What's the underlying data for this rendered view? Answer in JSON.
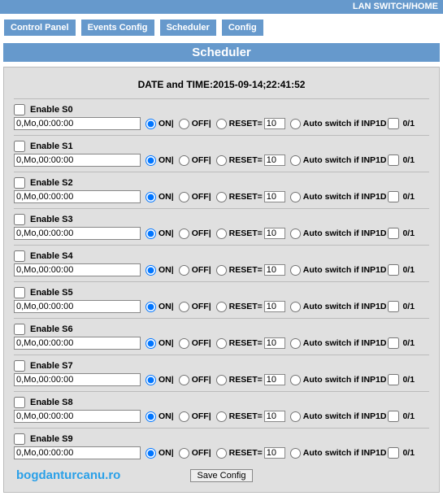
{
  "topbar": {
    "text": "LAN SWITCH/HOME"
  },
  "tabs": [
    {
      "label": "Control Panel"
    },
    {
      "label": "Events Config"
    },
    {
      "label": "Scheduler"
    },
    {
      "label": "Config"
    }
  ],
  "title": "Scheduler",
  "datetime_label": "DATE and TIME:",
  "datetime_value": "2015-09-14;22:41:52",
  "labels": {
    "on": "ON|",
    "off": "OFF|",
    "reset": "RESET=",
    "auto": "Auto switch if INP1D",
    "zeroone": "0/1"
  },
  "rows": [
    {
      "enable_label": "Enable S0",
      "value": "0,Mo,00:00:00",
      "reset": "10"
    },
    {
      "enable_label": "Enable S1",
      "value": "0,Mo,00:00:00",
      "reset": "10"
    },
    {
      "enable_label": "Enable S2",
      "value": "0,Mo,00:00:00",
      "reset": "10"
    },
    {
      "enable_label": "Enable S3",
      "value": "0,Mo,00:00:00",
      "reset": "10"
    },
    {
      "enable_label": "Enable S4",
      "value": "0,Mo,00:00:00",
      "reset": "10"
    },
    {
      "enable_label": "Enable S5",
      "value": "0,Mo,00:00:00",
      "reset": "10"
    },
    {
      "enable_label": "Enable S6",
      "value": "0,Mo,00:00:00",
      "reset": "10"
    },
    {
      "enable_label": "Enable S7",
      "value": "0,Mo,00:00:00",
      "reset": "10"
    },
    {
      "enable_label": "Enable S8",
      "value": "0,Mo,00:00:00",
      "reset": "10"
    },
    {
      "enable_label": "Enable S9",
      "value": "0,Mo,00:00:00",
      "reset": "10"
    }
  ],
  "save_label": "Save Config",
  "watermark": "bogdanturcanu.ro"
}
